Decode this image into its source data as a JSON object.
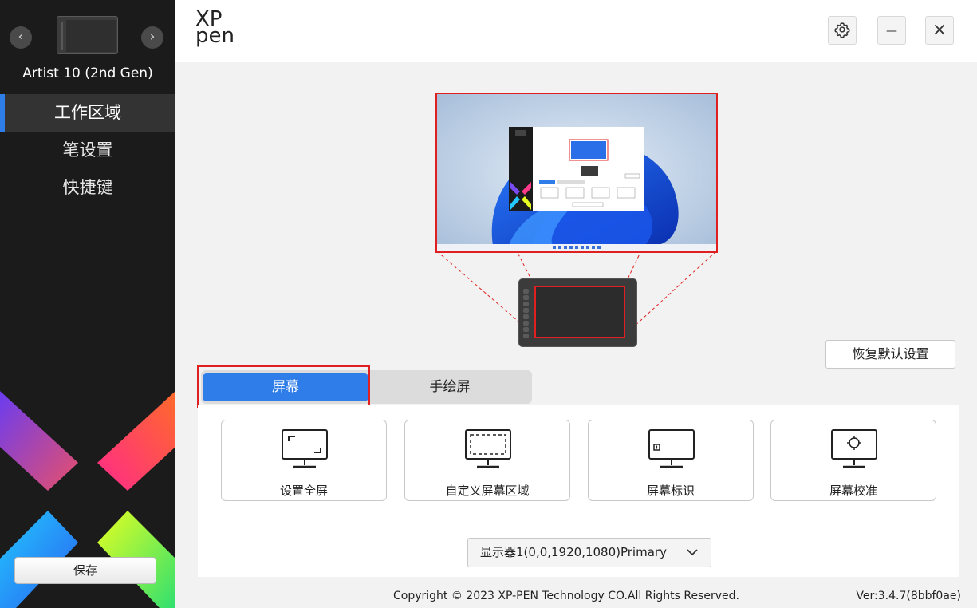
{
  "sidebar": {
    "prev_icon": "chevron-left-icon",
    "next_icon": "chevron-right-icon",
    "prev_glyph": "‹",
    "next_glyph": "›",
    "device_name": "Artist 10 (2nd Gen)",
    "menu": [
      {
        "label": "工作区域",
        "active": true
      },
      {
        "label": "笔设置",
        "active": false
      },
      {
        "label": "快捷键",
        "active": false
      }
    ],
    "save_label": "保存"
  },
  "header": {
    "logo_line1": "XP",
    "logo_line2": "pen",
    "settings_icon": "gear-icon",
    "minimize_glyph": "—",
    "close_glyph": "×"
  },
  "main": {
    "reset_label": "恢复默认设置",
    "tabs": [
      {
        "label": "屏幕",
        "active": true
      },
      {
        "label": "手绘屏",
        "active": false
      }
    ],
    "cards": [
      {
        "label": "设置全屏",
        "icon": "fullscreen-monitor-icon"
      },
      {
        "label": "自定义屏幕区域",
        "icon": "custom-area-monitor-icon"
      },
      {
        "label": "屏幕标识",
        "icon": "identify-monitor-icon"
      },
      {
        "label": "屏幕校准",
        "icon": "calibrate-monitor-icon"
      }
    ],
    "monitor_select": {
      "value": "显示器1(0,0,1920,1080)Primary",
      "icon": "chevron-down-icon"
    }
  },
  "footer": {
    "copyright": "Copyright © 2023  XP-PEN Technology CO.All Rights Reserved.",
    "version": "Ver:3.4.7(8bbf0ae)"
  },
  "colors": {
    "accent": "#2f7de8",
    "highlight": "#e02020",
    "sidebar_bg": "#1b1b1b"
  }
}
